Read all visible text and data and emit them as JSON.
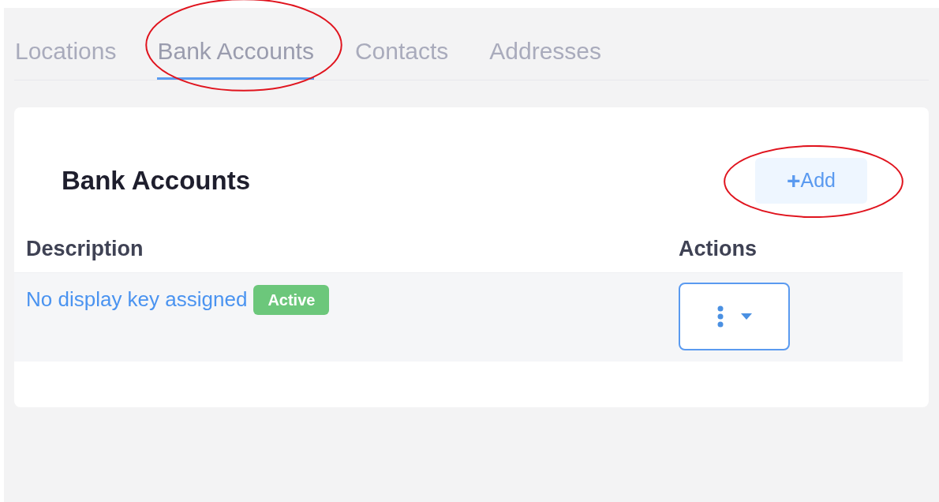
{
  "tabs": [
    {
      "label": "Locations",
      "selected": false,
      "circled": false
    },
    {
      "label": "Bank Accounts",
      "selected": true,
      "circled": true
    },
    {
      "label": "Contacts",
      "selected": false,
      "circled": false
    },
    {
      "label": "Addresses",
      "selected": false,
      "circled": false
    }
  ],
  "card": {
    "title": "Bank Accounts",
    "add_button": {
      "icon": "+",
      "label": "Add",
      "circled": true
    },
    "table": {
      "columns": [
        "Description",
        "Actions"
      ],
      "rows": [
        {
          "description": "No display key assigned",
          "status": "Active"
        }
      ]
    }
  }
}
